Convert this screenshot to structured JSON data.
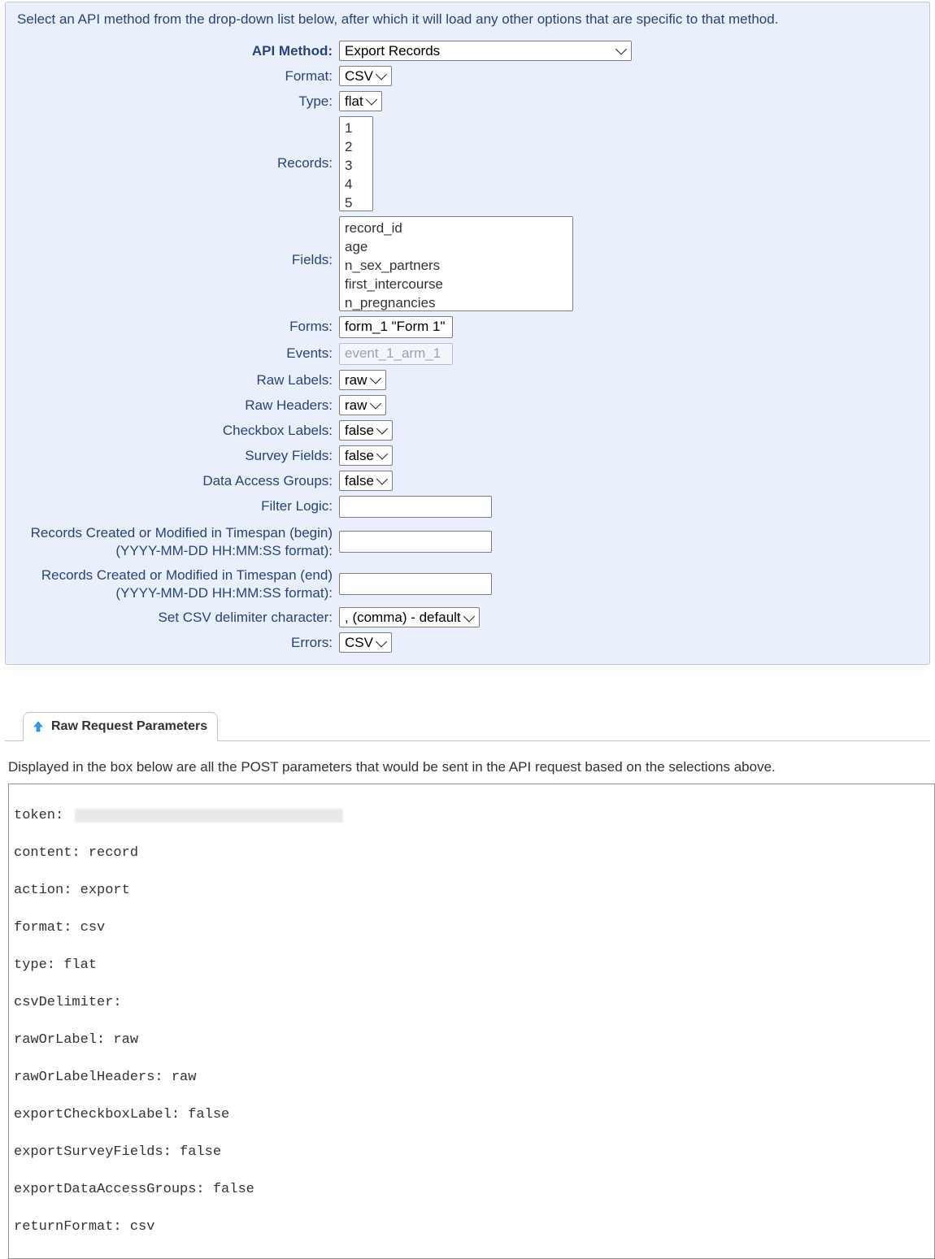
{
  "intro": "Select an API method from the drop-down list below, after which it will load any other options that are specific to that method.",
  "labels": {
    "api_method": "API Method:",
    "format": "Format:",
    "type": "Type:",
    "records": "Records:",
    "fields": "Fields:",
    "forms": "Forms:",
    "events": "Events:",
    "raw_labels": "Raw Labels:",
    "raw_headers": "Raw Headers:",
    "checkbox_labels": "Checkbox Labels:",
    "survey_fields": "Survey Fields:",
    "dags": "Data Access Groups:",
    "filter_logic": "Filter Logic:",
    "timespan_begin": "Records Created or Modified in Timespan (begin) (YYYY-MM-DD HH:MM:SS format):",
    "timespan_end": "Records Created or Modified in Timespan (end) (YYYY-MM-DD HH:MM:SS format):",
    "csv_delim": "Set CSV delimiter character:",
    "errors": "Errors:"
  },
  "values": {
    "api_method": "Export Records",
    "format": "CSV",
    "type": "flat",
    "records": [
      "1",
      "2",
      "3",
      "4",
      "5"
    ],
    "fields": [
      "record_id",
      "age",
      "n_sex_partners",
      "first_intercourse",
      "n_pregnancies"
    ],
    "forms": "form_1 \"Form 1\"",
    "events": "event_1_arm_1",
    "raw_labels": "raw",
    "raw_headers": "raw",
    "checkbox_labels": "false",
    "survey_fields": "false",
    "dags": "false",
    "filter_logic": "",
    "timespan_begin": "",
    "timespan_end": "",
    "csv_delim": ", (comma) - default",
    "errors": "CSV"
  },
  "tab": {
    "title": "Raw Request Parameters"
  },
  "raw": {
    "description": "Displayed in the box below are all the POST parameters that would be sent in the API request based on the selections above.",
    "lines": [
      "token: ",
      "content: record",
      "action: export",
      "format: csv",
      "type: flat",
      "csvDelimiter:",
      "rawOrLabel: raw",
      "rawOrLabelHeaders: raw",
      "exportCheckboxLabel: false",
      "exportSurveyFields: false",
      "exportDataAccessGroups: false",
      "returnFormat: csv"
    ]
  }
}
